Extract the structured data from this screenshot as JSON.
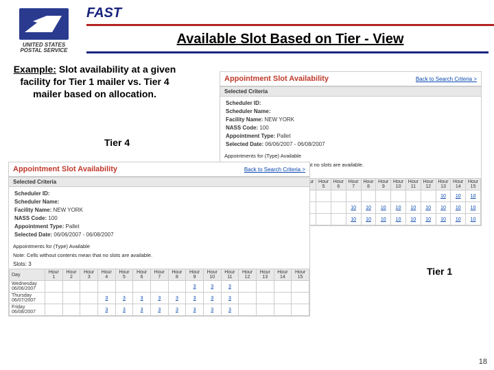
{
  "header": {
    "brand": "FAST",
    "logo_text1": "UNITED STATES",
    "logo_text2": "POSTAL SERVICE",
    "subtitle": "Available Slot Based on Tier - View"
  },
  "example": {
    "label": "Example:",
    "text": "Slot availability at a given facility for Tier 1 mailer vs. Tier 4 mailer based on allocation."
  },
  "labels": {
    "tier4": "Tier  4",
    "tier1": "Tier 1"
  },
  "panel_common": {
    "title": "Appointment Slot Availability",
    "back": "Back to Search Criteria >",
    "criteria_header": "Selected Criteria",
    "scheduler_id_label": "Scheduler ID:",
    "scheduler_name_label": "Scheduler Name:",
    "facility_name_label": "Facility Name:",
    "facility_name": "NEW YORK",
    "nass_label": "NASS Code:",
    "nass": "100",
    "appt_type_label": "Appointment Type:",
    "appt_type": "Pallet",
    "sel_date_label": "Selected Date:",
    "sel_date": "06/06/2007 - 06/08/2007",
    "appts_for": "Appointments for (Type) Available",
    "note": "Note: Cells without contents mean that no slots are available.",
    "slots_label": "Slots: 3"
  },
  "hours": [
    "Hour 1",
    "Hour 2",
    "Hour 3",
    "Hour 4",
    "Hour 5",
    "Hour 6",
    "Hour 7",
    "Hour 8",
    "Hour 9",
    "Hour 10",
    "Hour 11",
    "Hour 12",
    "Hour 13",
    "Hour 14",
    "Hour 15"
  ],
  "days": [
    {
      "name": "Wednesday",
      "date": "06/06/2007"
    },
    {
      "name": "Thursday",
      "date": "06/07/2007"
    },
    {
      "name": "Friday",
      "date": "06/08/2007"
    }
  ],
  "tier1_rows": [
    [
      "",
      "",
      "",
      "",
      "",
      "",
      "",
      "",
      "",
      "",
      "",
      "",
      "10",
      "10",
      "10"
    ],
    [
      "",
      "",
      "",
      "",
      "",
      "",
      "10",
      "10",
      "10",
      "10",
      "10",
      "10",
      "10",
      "10",
      "10"
    ],
    [
      "",
      "",
      "",
      "",
      "",
      "",
      "10",
      "10",
      "10",
      "10",
      "10",
      "10",
      "10",
      "10",
      "10"
    ]
  ],
  "tier4_rows": [
    [
      "",
      "",
      "",
      "",
      "",
      "",
      "",
      "",
      "3",
      "3",
      "3",
      "",
      "",
      "",
      ""
    ],
    [
      "",
      "",
      "",
      "3",
      "3",
      "3",
      "3",
      "3",
      "3",
      "3",
      "3",
      "",
      "",
      "",
      ""
    ],
    [
      "",
      "",
      "",
      "3",
      "3",
      "3",
      "3",
      "3",
      "3",
      "3",
      "3",
      "",
      "",
      "",
      ""
    ]
  ],
  "page_number": "18",
  "chart_data": [
    {
      "type": "table",
      "title": "Tier 1 slot availability",
      "categories": [
        "Hour 1",
        "Hour 2",
        "Hour 3",
        "Hour 4",
        "Hour 5",
        "Hour 6",
        "Hour 7",
        "Hour 8",
        "Hour 9",
        "Hour 10",
        "Hour 11",
        "Hour 12",
        "Hour 13",
        "Hour 14",
        "Hour 15"
      ],
      "series": [
        {
          "name": "Wednesday 06/06/2007",
          "values": [
            null,
            null,
            null,
            null,
            null,
            null,
            null,
            null,
            null,
            null,
            null,
            null,
            10,
            10,
            10
          ]
        },
        {
          "name": "Thursday 06/07/2007",
          "values": [
            null,
            null,
            null,
            null,
            null,
            null,
            10,
            10,
            10,
            10,
            10,
            10,
            10,
            10,
            10
          ]
        },
        {
          "name": "Friday 06/08/2007",
          "values": [
            null,
            null,
            null,
            null,
            null,
            null,
            10,
            10,
            10,
            10,
            10,
            10,
            10,
            10,
            10
          ]
        }
      ]
    },
    {
      "type": "table",
      "title": "Tier 4 slot availability",
      "categories": [
        "Hour 1",
        "Hour 2",
        "Hour 3",
        "Hour 4",
        "Hour 5",
        "Hour 6",
        "Hour 7",
        "Hour 8",
        "Hour 9",
        "Hour 10",
        "Hour 11",
        "Hour 12",
        "Hour 13",
        "Hour 14",
        "Hour 15"
      ],
      "series": [
        {
          "name": "Wednesday 06/06/2007",
          "values": [
            null,
            null,
            null,
            null,
            null,
            null,
            null,
            null,
            3,
            3,
            3,
            null,
            null,
            null,
            null
          ]
        },
        {
          "name": "Thursday 06/07/2007",
          "values": [
            null,
            null,
            null,
            3,
            3,
            3,
            3,
            3,
            3,
            3,
            3,
            null,
            null,
            null,
            null
          ]
        },
        {
          "name": "Friday 06/08/2007",
          "values": [
            null,
            null,
            null,
            3,
            3,
            3,
            3,
            3,
            3,
            3,
            3,
            null,
            null,
            null,
            null
          ]
        }
      ]
    }
  ]
}
